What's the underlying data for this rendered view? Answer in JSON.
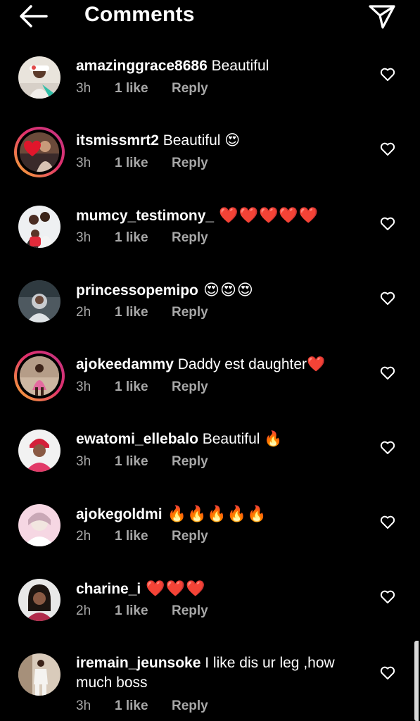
{
  "header": {
    "title": "Comments",
    "back_icon": "arrow-left-icon",
    "share_icon": "paper-plane-icon"
  },
  "comments": [
    {
      "username": "amazinggrace8686",
      "text": " Beautiful",
      "time": "3h",
      "likes": "1 like",
      "reply": "Reply"
    },
    {
      "username": "itsmissmrt2",
      "text": " Beautiful 😍",
      "time": "3h",
      "likes": "1 like",
      "reply": "Reply"
    },
    {
      "username": "mumcy_testimony_",
      "text": " ❤️❤️❤️❤️❤️",
      "time": "3h",
      "likes": "1 like",
      "reply": "Reply"
    },
    {
      "username": "princessopemipo",
      "text": " 😍😍😍",
      "time": "2h",
      "likes": "1 like",
      "reply": "Reply"
    },
    {
      "username": "ajokeedammy",
      "text": " Daddy est daughter❤️",
      "time": "3h",
      "likes": "1 like",
      "reply": "Reply"
    },
    {
      "username": "ewatomi_ellebalo",
      "text": " Beautiful 🔥",
      "time": "3h",
      "likes": "1 like",
      "reply": "Reply"
    },
    {
      "username": "ajokegoldmi",
      "text": " 🔥🔥🔥🔥🔥",
      "time": "2h",
      "likes": "1 like",
      "reply": "Reply"
    },
    {
      "username": "charine_i",
      "text": " ❤️❤️❤️",
      "time": "2h",
      "likes": "1 like",
      "reply": "Reply"
    },
    {
      "username": "iremain_jeunsoke",
      "text": " I like dis ur leg ,how much boss",
      "time": "3h",
      "likes": "1 like",
      "reply": "Reply"
    }
  ],
  "colors": {
    "background": "#000000",
    "text": "#ffffff",
    "secondary": "#a8a8a8",
    "story_ring": "#e1306c",
    "heart_red": "#e0162b"
  }
}
